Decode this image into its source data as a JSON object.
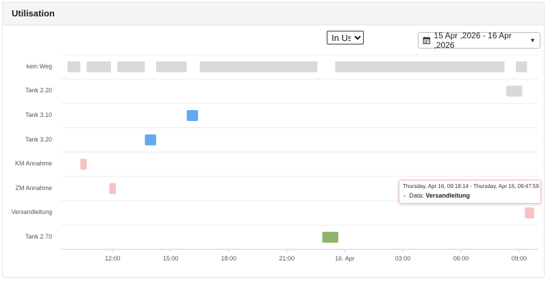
{
  "panel": {
    "title": "Utilisation"
  },
  "filter": {
    "selected": "In Use"
  },
  "date_range": {
    "label": "15 Apr ,2026 - 16 Apr ,2026",
    "icon": "calendar-icon"
  },
  "colors": {
    "no_route": "#d8d9dc",
    "tank": "#63a9f1",
    "intake": "#f7c2c2",
    "tank_270": "#8fb66b",
    "gridline": "#ececec"
  },
  "chart_data": {
    "type": "timeline",
    "rows": [
      "kein Weg",
      "Tank 2.20",
      "Tank 3.10",
      "Tank 3.20",
      "KM Annahme",
      "ZM Annahme",
      "Versandleitung",
      "Tank 2.70"
    ],
    "x_ticks": [
      "12:00",
      "15:00",
      "18:00",
      "21:00",
      "16. Apr",
      "03:00",
      "06:00",
      "09:00"
    ],
    "xlim": [
      "2026-04-15T09:20",
      "2026-04-16T10:00"
    ],
    "grid": true,
    "segments": [
      {
        "row": "kein Weg",
        "start": "2026-04-15T09:40",
        "end": "2026-04-15T10:20",
        "color": "no_route"
      },
      {
        "row": "kein Weg",
        "start": "2026-04-15T10:40",
        "end": "2026-04-15T11:55",
        "color": "no_route"
      },
      {
        "row": "kein Weg",
        "start": "2026-04-15T12:15",
        "end": "2026-04-15T13:40",
        "color": "no_route"
      },
      {
        "row": "kein Weg",
        "start": "2026-04-15T14:15",
        "end": "2026-04-15T15:50",
        "color": "no_route"
      },
      {
        "row": "kein Weg",
        "start": "2026-04-15T16:30",
        "end": "2026-04-15T22:35",
        "color": "no_route"
      },
      {
        "row": "kein Weg",
        "start": "2026-04-15T23:30",
        "end": "2026-04-16T08:15",
        "color": "no_route"
      },
      {
        "row": "kein Weg",
        "start": "2026-04-16T08:50",
        "end": "2026-04-16T09:25",
        "color": "no_route"
      },
      {
        "row": "Tank 2.20",
        "start": "2026-04-16T08:20",
        "end": "2026-04-16T09:10",
        "color": "no_route"
      },
      {
        "row": "Tank 3.10",
        "start": "2026-04-15T15:50",
        "end": "2026-04-15T16:25",
        "color": "tank"
      },
      {
        "row": "Tank 3.20",
        "start": "2026-04-15T13:40",
        "end": "2026-04-15T14:15",
        "color": "tank"
      },
      {
        "row": "KM Annahme",
        "start": "2026-04-15T10:20",
        "end": "2026-04-15T10:40",
        "color": "intake"
      },
      {
        "row": "ZM Annahme",
        "start": "2026-04-15T11:50",
        "end": "2026-04-15T12:10",
        "color": "intake"
      },
      {
        "row": "Versandleitung",
        "start": "2026-04-16T09:18",
        "end": "2026-04-16T09:47",
        "color": "intake"
      },
      {
        "row": "Tank 2.70",
        "start": "2026-04-15T22:50",
        "end": "2026-04-15T23:40",
        "color": "tank_270"
      }
    ]
  },
  "tooltip": {
    "range": "Thursday, Apr 16, 09:18:14 - Thursday, Apr 16, 09:47:59",
    "label": "Data:",
    "value": "Versandleitung"
  }
}
